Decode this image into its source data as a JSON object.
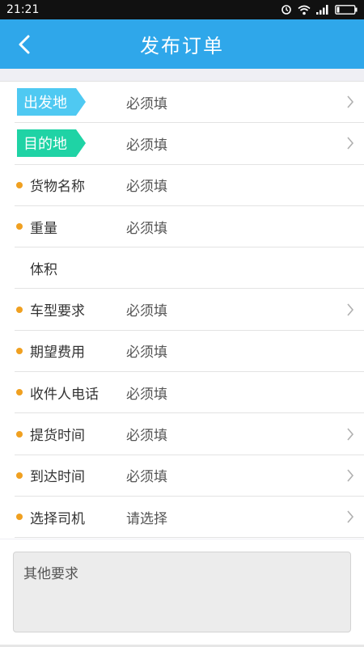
{
  "status_bar": {
    "time": "21:21"
  },
  "header": {
    "title": "发布订单",
    "back_icon": "chevron-left-icon"
  },
  "form": {
    "origin": {
      "label": "出发地",
      "value": "必须填"
    },
    "destination": {
      "label": "目的地",
      "value": "必须填"
    },
    "rows": [
      {
        "label": "货物名称",
        "value": "必须填",
        "required": true,
        "has_arrow": false
      },
      {
        "label": "重量",
        "value": "必须填",
        "required": true,
        "has_arrow": false
      },
      {
        "label": "体积",
        "value": "",
        "required": false,
        "has_arrow": false
      },
      {
        "label": "车型要求",
        "value": "必须填",
        "required": true,
        "has_arrow": true
      },
      {
        "label": "期望费用",
        "value": "必须填",
        "required": true,
        "has_arrow": false
      },
      {
        "label": "收件人电话",
        "value": "必须填",
        "required": true,
        "has_arrow": false
      },
      {
        "label": "提货时间",
        "value": "必须填",
        "required": true,
        "has_arrow": true
      },
      {
        "label": "到达时间",
        "value": "必须填",
        "required": true,
        "has_arrow": true
      },
      {
        "label": "选择司机",
        "value": "请选择",
        "required": true,
        "has_arrow": true
      }
    ]
  },
  "remarks": {
    "placeholder": "其他要求"
  },
  "colors": {
    "header": "#2fa7ea",
    "origin_tag": "#4fc9f2",
    "destination_tag": "#1fd3a5",
    "required_dot": "#f0a020"
  }
}
